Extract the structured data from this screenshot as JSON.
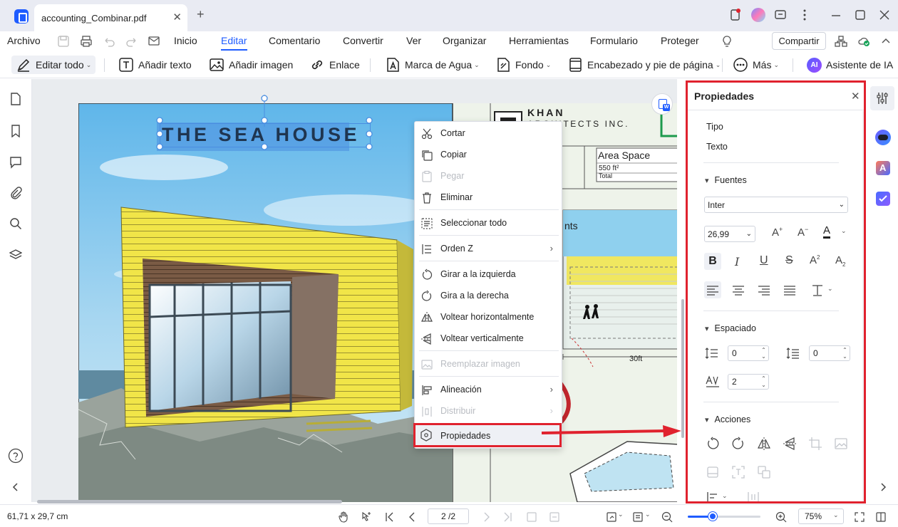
{
  "title_bar": {
    "tab_title": "accounting_Combinar.pdf",
    "close_glyph": "✕",
    "new_tab_glyph": "+"
  },
  "menu": {
    "file": "Archivo",
    "items": [
      "Inicio",
      "Editar",
      "Comentario",
      "Convertir",
      "Ver",
      "Organizar",
      "Herramientas",
      "Formulario",
      "Proteger"
    ],
    "active": "Editar",
    "share": "Compartir"
  },
  "toolbar": {
    "edit_all": "Editar todo",
    "add_text": "Añadir texto",
    "add_image": "Añadir imagen",
    "link": "Enlace",
    "watermark": "Marca de Agua",
    "background": "Fondo",
    "header_footer": "Encabezado y pie de página",
    "more": "Más",
    "ai_badge": "AI",
    "ai_assistant": "Asistente de IA"
  },
  "document": {
    "heading": "THE SEA HOUSE",
    "company_line1": "KHAN",
    "company_line2": "ARCHITECTS INC.",
    "area_title": "Area Space",
    "area_value": "550 ft²",
    "area_total": "Total",
    "side_text": "nts",
    "dimension": "30ft"
  },
  "context_menu": {
    "cut": "Cortar",
    "copy": "Copiar",
    "paste": "Pegar",
    "delete": "Eliminar",
    "select_all": "Seleccionar todo",
    "order_z": "Orden Z",
    "rotate_left": "Girar a la izquierda",
    "rotate_right": "Gira a la derecha",
    "flip_h": "Voltear horizontalmente",
    "flip_v": "Voltear verticalmente",
    "replace_image": "Reemplazar imagen",
    "align": "Alineación",
    "distribute": "Distribuir",
    "properties": "Propiedades"
  },
  "properties": {
    "title": "Propiedades",
    "type_label": "Tipo",
    "type_value": "Texto",
    "fonts_header": "Fuentes",
    "font_name": "Inter",
    "font_size": "26,99",
    "spacing_header": "Espaciado",
    "line_spacing": "0",
    "para_spacing": "0",
    "char_spacing": "2",
    "actions_header": "Acciones"
  },
  "status": {
    "coords": "61,71 x 29,7 cm",
    "page": "2 /2",
    "zoom": "75%"
  },
  "colors": {
    "accent": "#1f5cff",
    "highlight": "#e0222e",
    "selection": "#4a8ee0"
  }
}
